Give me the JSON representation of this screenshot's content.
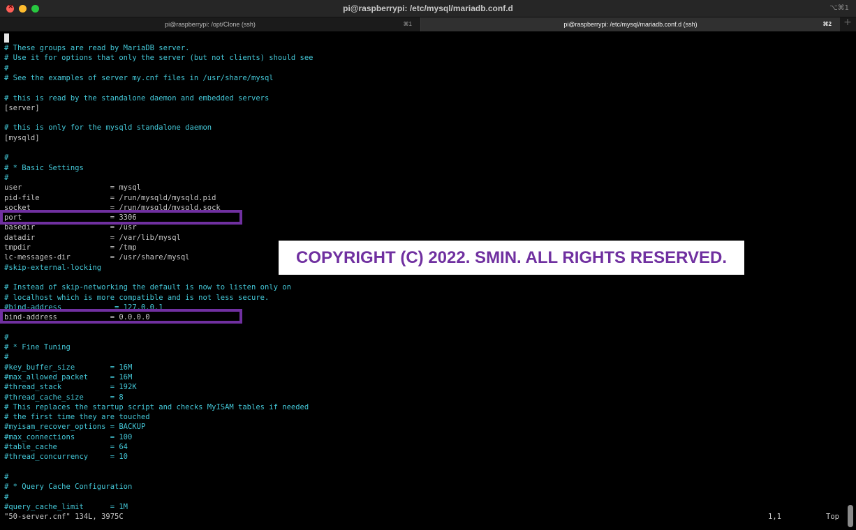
{
  "window": {
    "title": "pi@raspberrypi: /etc/mysql/mariadb.conf.d",
    "shortcut": "⌥⌘1"
  },
  "tabs": [
    {
      "label": "pi@raspberrypi: /opt/Clone (ssh)",
      "shortcut": "⌘1"
    },
    {
      "label": "pi@raspberrypi: /etc/mysql/mariadb.conf.d (ssh)",
      "shortcut": "⌘2"
    }
  ],
  "tab_add": "+",
  "lines": [
    {
      "text": "# These groups are read by MariaDB server.",
      "style": "comment"
    },
    {
      "text": "# Use it for options that only the server (but not clients) should see",
      "style": "comment"
    },
    {
      "text": "#",
      "style": "comment"
    },
    {
      "text": "# See the examples of server my.cnf files in /usr/share/mysql",
      "style": "comment"
    },
    {
      "text": "",
      "style": "comment"
    },
    {
      "text": "# this is read by the standalone daemon and embedded servers",
      "style": "comment"
    },
    {
      "text": "[server]",
      "style": "plain"
    },
    {
      "text": "",
      "style": "comment"
    },
    {
      "text": "# this is only for the mysqld standalone daemon",
      "style": "comment"
    },
    {
      "text": "[mysqld]",
      "style": "plain"
    },
    {
      "text": "",
      "style": "comment"
    },
    {
      "text": "#",
      "style": "comment"
    },
    {
      "text": "# * Basic Settings",
      "style": "comment"
    },
    {
      "text": "#",
      "style": "comment"
    },
    {
      "text": "user                    = mysql",
      "style": "plain"
    },
    {
      "text": "pid-file                = /run/mysqld/mysqld.pid",
      "style": "plain"
    },
    {
      "text": "socket                  = /run/mysqld/mysqld.sock",
      "style": "plain"
    },
    {
      "text": "port                    = 3306",
      "style": "plain"
    },
    {
      "text": "basedir                 = /usr",
      "style": "plain"
    },
    {
      "text": "datadir                 = /var/lib/mysql",
      "style": "plain"
    },
    {
      "text": "tmpdir                  = /tmp",
      "style": "plain"
    },
    {
      "text": "lc-messages-dir         = /usr/share/mysql",
      "style": "plain"
    },
    {
      "text": "#skip-external-locking",
      "style": "comment"
    },
    {
      "text": "",
      "style": "comment"
    },
    {
      "text": "# Instead of skip-networking the default is now to listen only on",
      "style": "comment"
    },
    {
      "text": "# localhost which is more compatible and is not less secure.",
      "style": "comment"
    },
    {
      "text": "#bind-address            = 127.0.0.1",
      "style": "comment"
    },
    {
      "text": "bind-address            = 0.0.0.0",
      "style": "plain"
    },
    {
      "text": "",
      "style": "comment"
    },
    {
      "text": "#",
      "style": "comment"
    },
    {
      "text": "# * Fine Tuning",
      "style": "comment"
    },
    {
      "text": "#",
      "style": "comment"
    },
    {
      "text": "#key_buffer_size        = 16M",
      "style": "comment"
    },
    {
      "text": "#max_allowed_packet     = 16M",
      "style": "comment"
    },
    {
      "text": "#thread_stack           = 192K",
      "style": "comment"
    },
    {
      "text": "#thread_cache_size      = 8",
      "style": "comment"
    },
    {
      "text": "# This replaces the startup script and checks MyISAM tables if needed",
      "style": "comment"
    },
    {
      "text": "# the first time they are touched",
      "style": "comment"
    },
    {
      "text": "#myisam_recover_options = BACKUP",
      "style": "comment"
    },
    {
      "text": "#max_connections        = 100",
      "style": "comment"
    },
    {
      "text": "#table_cache            = 64",
      "style": "comment"
    },
    {
      "text": "#thread_concurrency     = 10",
      "style": "comment"
    },
    {
      "text": "",
      "style": "comment"
    },
    {
      "text": "#",
      "style": "comment"
    },
    {
      "text": "# * Query Cache Configuration",
      "style": "comment"
    },
    {
      "text": "#",
      "style": "comment"
    },
    {
      "text": "#query_cache_limit      = 1M",
      "style": "comment"
    }
  ],
  "status": {
    "file": "\"50-server.cnf\" 134L, 3975C",
    "position": "1,1",
    "scroll": "Top"
  },
  "watermark": "COPYRIGHT (C) 2022. SMIN. ALL RIGHTS RESERVED.",
  "colors": {
    "comment": "#44c8d8",
    "plain": "#c7c7c7",
    "highlight_box": "#7030a0",
    "background": "#000000"
  }
}
